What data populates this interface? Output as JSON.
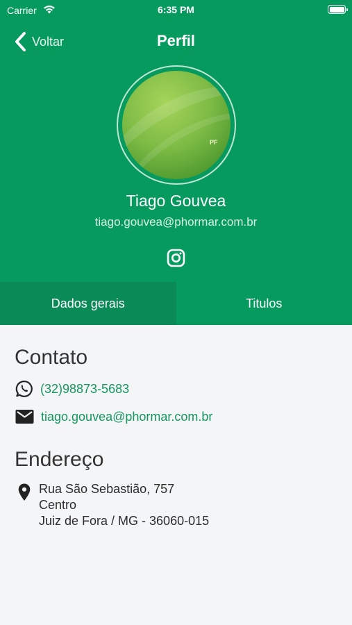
{
  "status_bar": {
    "carrier": "Carrier",
    "time": "6:35 PM",
    "battery_level": 1.0
  },
  "nav": {
    "back_label": "Voltar",
    "title": "Perfil"
  },
  "profile": {
    "name": "Tiago Gouvea",
    "email": "tiago.gouvea@phormar.com.br",
    "social_icon": "instagram-icon"
  },
  "tabs": [
    {
      "label": "Dados gerais",
      "active": true
    },
    {
      "label": "Titulos",
      "active": false
    }
  ],
  "contact": {
    "title": "Contato",
    "phone": "(32)98873-5683",
    "email": "tiago.gouvea@phormar.com.br",
    "link_color": "#16965f"
  },
  "address": {
    "title": "Endereço",
    "line1": "Rua São Sebastião, 757",
    "line2": "Centro",
    "line3": "Juiz de Fora / MG - 36060-015"
  },
  "colors": {
    "primary": "#069a5e",
    "tab_active": "#098a57",
    "background": "#f4f5f7"
  }
}
